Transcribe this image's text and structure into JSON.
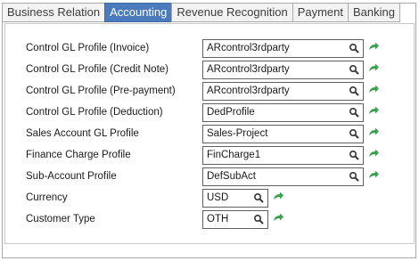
{
  "tabs": [
    {
      "label": "Business Relation",
      "active": false
    },
    {
      "label": "Accounting",
      "active": true
    },
    {
      "label": "Revenue Recognition",
      "active": false
    },
    {
      "label": "Payment",
      "active": false
    },
    {
      "label": "Banking",
      "active": false
    }
  ],
  "fields": [
    {
      "label": "Control GL Profile (Invoice)",
      "value": "ARcontrol3rdparty"
    },
    {
      "label": "Control GL Profile (Credit Note)",
      "value": "ARcontrol3rdparty"
    },
    {
      "label": "Control GL Profile (Pre-payment)",
      "value": "ARcontrol3rdparty"
    },
    {
      "label": "Control GL Profile (Deduction)",
      "value": "DedProfile"
    },
    {
      "label": "Sales Account GL Profile",
      "value": "Sales-Project"
    },
    {
      "label": "Finance Charge Profile",
      "value": "FinCharge1"
    },
    {
      "label": "Sub-Account Profile",
      "value": "DefSubAct"
    },
    {
      "label": "Currency",
      "value": "USD"
    },
    {
      "label": "Customer Type",
      "value": "OTH"
    }
  ],
  "colors": {
    "active_tab": "#4b7bbd",
    "go_arrow": "#3aa14a"
  },
  "icons": {
    "lookup": "search-icon",
    "navigate": "go-arrow-icon"
  }
}
